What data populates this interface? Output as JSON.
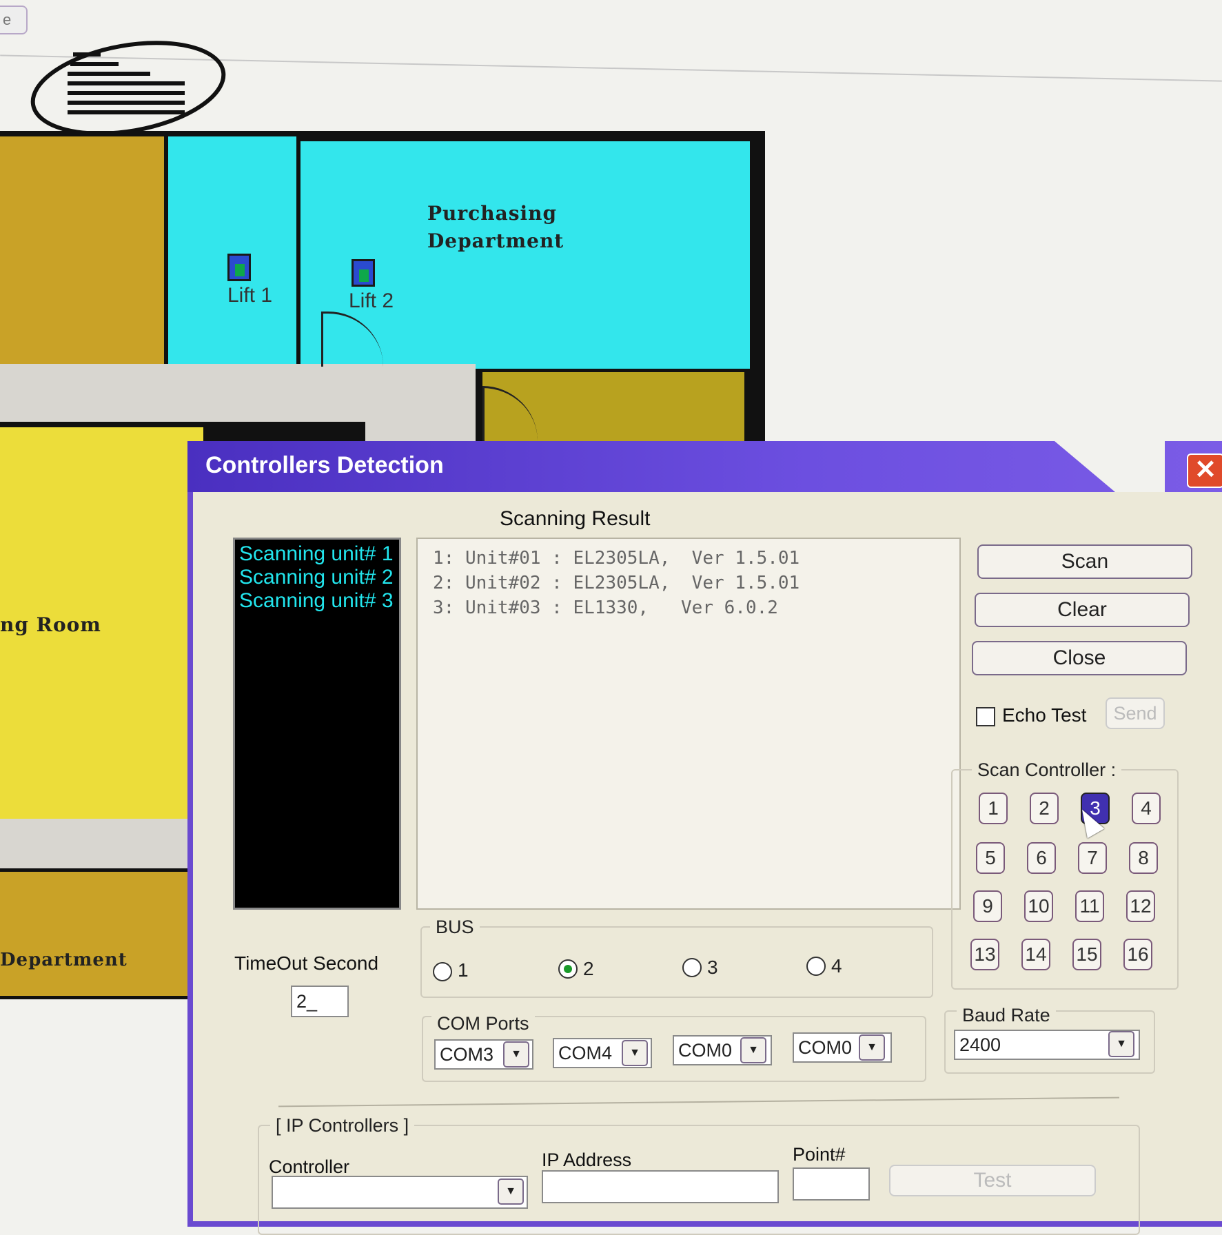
{
  "background": {
    "top_button_label": "e",
    "rooms": {
      "purchasing": "Purchasing\nDepartment",
      "meeting_room": "ng Room",
      "department": "Department"
    },
    "lifts": [
      "Lift 1",
      "Lift 2"
    ],
    "colors": {
      "cyan": "#33e6ec",
      "mustard": "#c9a227",
      "yellow": "#ecdd3a",
      "olive": "#b8a21f"
    }
  },
  "dialog": {
    "title": "Controllers Detection",
    "close_label": "✕",
    "scanning_result_label": "Scanning Result",
    "log_lines": [
      "Scanning unit# 1",
      "Scanning unit# 2",
      "Scanning unit# 3"
    ],
    "results": [
      "1: Unit#01 : EL2305LA,  Ver 1.5.01",
      "2: Unit#02 : EL2305LA,  Ver 1.5.01",
      "3: Unit#03 : EL1330,   Ver 6.0.2"
    ],
    "buttons": {
      "scan": "Scan",
      "clear": "Clear",
      "close": "Close",
      "send": "Send",
      "test": "Test"
    },
    "echo_test_label": "Echo Test",
    "scan_controller_label": "Scan Controller :",
    "controllers": [
      "1",
      "2",
      "3",
      "4",
      "5",
      "6",
      "7",
      "8",
      "9",
      "10",
      "11",
      "12",
      "13",
      "14",
      "15",
      "16"
    ],
    "selected_controller": "3",
    "timeout_label": "TimeOut Second",
    "timeout_value": "2_",
    "bus_label": "BUS",
    "bus_options": [
      "1",
      "2",
      "3",
      "4"
    ],
    "bus_selected": "2",
    "com_ports_label": "COM Ports",
    "com_ports": [
      "COM3",
      "COM4",
      "COM0",
      "COM0"
    ],
    "baud_rate_label": "Baud Rate",
    "baud_rate": "2400",
    "ip_controllers_label": "[ IP Controllers ]",
    "ip_fields": {
      "controller": "Controller",
      "ip_address": "IP Address",
      "point": "Point#"
    },
    "accent_color": "#5a3ed0"
  }
}
